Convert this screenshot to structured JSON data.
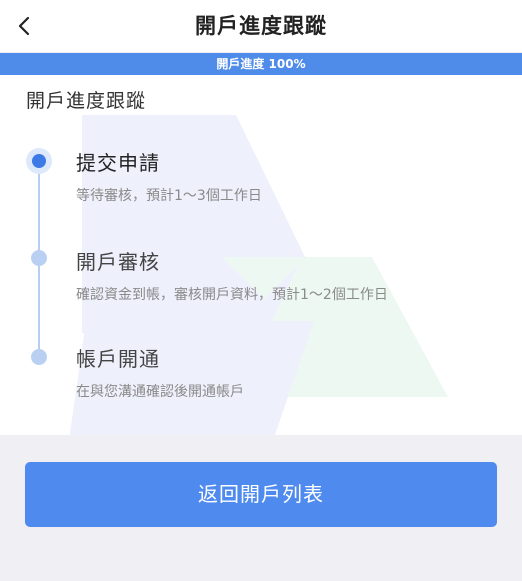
{
  "header": {
    "title": "開戶進度跟蹤",
    "back_icon": "chevron-left-icon"
  },
  "progress": {
    "label": "開戶進度 100%",
    "percent": 100,
    "color": "#4f8be8"
  },
  "section": {
    "title": "開戶進度跟蹤"
  },
  "steps": [
    {
      "title": "提交申請",
      "description": "等待審核，預計1～3個工作日",
      "state": "active"
    },
    {
      "title": "開戶審核",
      "description": "確認資金到帳，審核開戶資料，預計1～2個工作日",
      "state": "pending"
    },
    {
      "title": "帳戶開通",
      "description": "在與您溝通確認後開通帳戶",
      "state": "pending"
    }
  ],
  "actions": {
    "return_label": "返回開戶列表"
  },
  "colors": {
    "accent": "#4f8bef",
    "active_dot": "#3d7ae6",
    "pending_dot": "#b9d0f3",
    "active_title": "#222222",
    "pending_title": "#444444"
  }
}
